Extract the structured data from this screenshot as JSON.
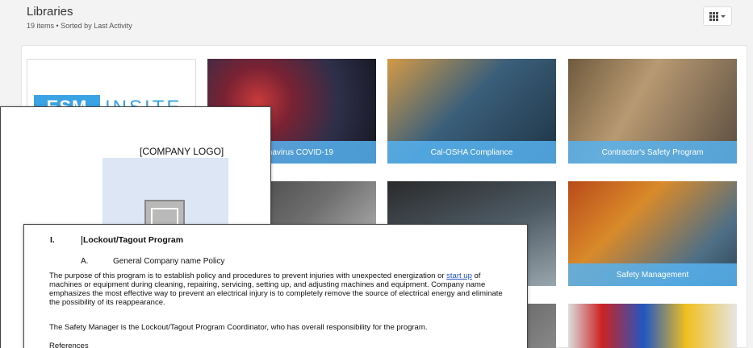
{
  "header": {
    "title": "Libraries",
    "meta": "19 items • Sorted by Last Activity",
    "view_toggle_icon": "grid-icon"
  },
  "cards": [
    {
      "label": "",
      "logo_text_box": "ESM",
      "logo_text_word": "INSITE"
    },
    {
      "label": "Coronavirus COVID-19"
    },
    {
      "label": "Cal-OSHA Compliance"
    },
    {
      "label": "Contractor's Safety Program"
    },
    {
      "label": ""
    },
    {
      "label": ""
    },
    {
      "label": "Safety Management"
    },
    {
      "label": ""
    },
    {
      "label": ""
    }
  ],
  "doc_back": {
    "company_logo": "[COMPANY LOGO]",
    "image_icon": "image-icon"
  },
  "doc_front": {
    "section_number": "I.",
    "section_title": "Lockout/Tagout Program",
    "sub_number": "A.",
    "sub_title": "General Company name Policy",
    "para_before": "The purpose of this program is to establish policy and procedures to prevent injuries with unexpected energization or ",
    "para_link": "start up",
    "para_after": " of machines or equipment during cleaning, repairing, servicing, setting up, and adjusting machines and equipment. Company name emphasizes the most effective way to prevent an electrical injury is to completely remove the source of electrical energy and eliminate the possibility of its reappearance.",
    "para2": "The Safety Manager is the Lockout/Tagout Program Coordinator, who has overall responsibility for the program.",
    "references": "References"
  }
}
